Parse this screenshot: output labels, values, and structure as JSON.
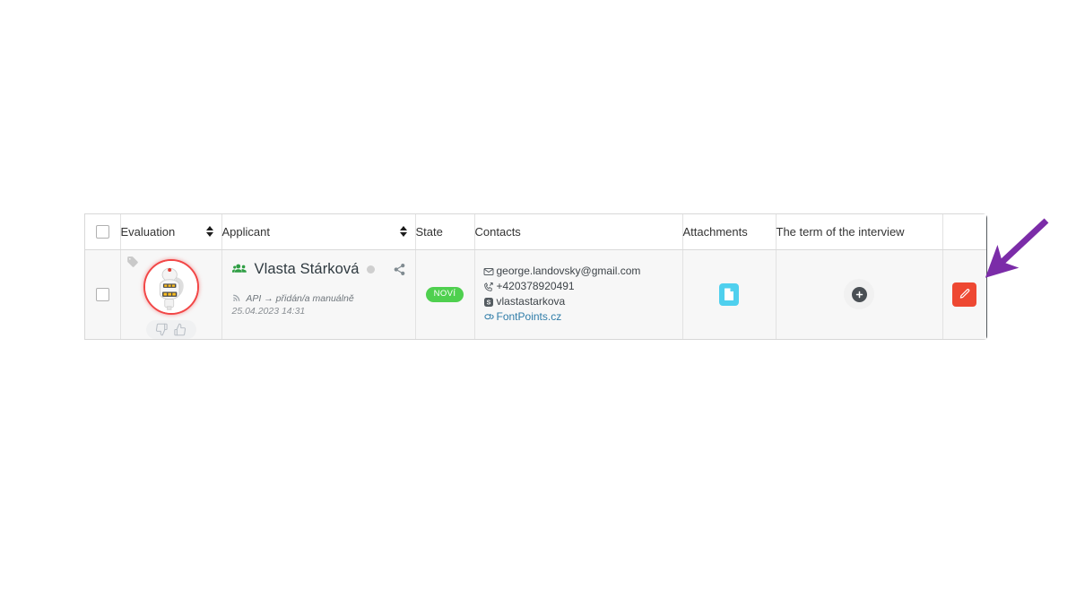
{
  "table": {
    "columns": [
      {
        "key": "select",
        "label": "",
        "sortable": false,
        "icon": "checkbox-icon"
      },
      {
        "key": "evaluation",
        "label": "Evaluation",
        "sortable": true
      },
      {
        "key": "applicant",
        "label": "Applicant",
        "sortable": true
      },
      {
        "key": "state",
        "label": "State",
        "sortable": false
      },
      {
        "key": "contacts",
        "label": "Contacts",
        "sortable": false
      },
      {
        "key": "attachments",
        "label": "Attachments",
        "sortable": false
      },
      {
        "key": "term",
        "label": "The term of the interview",
        "sortable": false
      },
      {
        "key": "actions",
        "label": "",
        "sortable": false
      }
    ],
    "rows": [
      {
        "selected": false,
        "tag_icon": "tag-icon",
        "avatar": {
          "alt": "robot-avatar",
          "ring_color": "#f24646"
        },
        "vote": {
          "down_icon": "thumbs-down-icon",
          "up_icon": "thumbs-up-icon"
        },
        "applicant": {
          "group_icon": "users-icon",
          "name": "Vlasta Stárková",
          "status_dot_color": "#cfcfcf",
          "share_icon": "share-icon",
          "source_icon": "rss-icon",
          "source": "API → přidán/a manuálně",
          "date": "25.04.2023 14:31"
        },
        "state": {
          "label": "NOVÍ",
          "color": "#4fd04f"
        },
        "contacts": [
          {
            "icon": "mail-icon",
            "text": "george.landovsky@gmail.com",
            "link": false
          },
          {
            "icon": "phone-icon",
            "text": "+420378920491",
            "link": false
          },
          {
            "icon": "skype-icon",
            "text": "vlastastarkova",
            "link": false
          },
          {
            "icon": "chat-icon",
            "text": "FontPoints.cz",
            "link": true
          }
        ],
        "attachment": {
          "icon": "file-icon",
          "color": "#4fd0ee"
        },
        "term": {
          "add_icon": "plus-icon"
        },
        "action": {
          "icon": "pencil-icon",
          "color": "#ee4832"
        }
      }
    ]
  },
  "annotation": {
    "arrow": {
      "color": "#7b2ca8",
      "points_to": "edit-button"
    }
  }
}
